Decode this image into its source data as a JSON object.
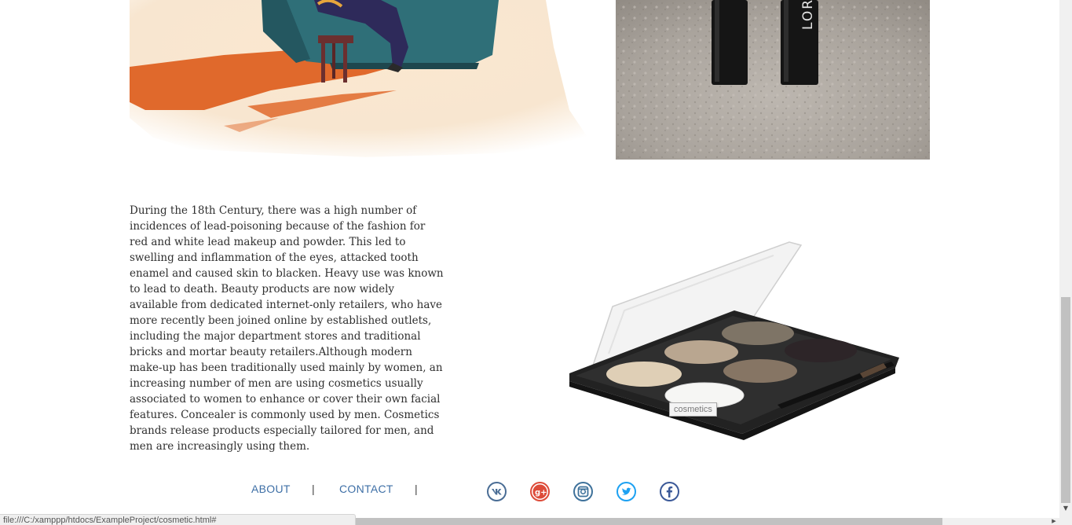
{
  "article": {
    "text": "During the 18th Century, there was a high number of incidences of lead-poisoning because of the fashion for red and white lead makeup and powder. This led to swelling and inflammation of the eyes, attacked tooth enamel and caused skin to blacken. Heavy use was known to lead to death. Beauty products are now widely available from dedicated internet-only retailers, who have more recently been joined online by established outlets, including the major department stores and traditional bricks and mortar beauty retailers.Although modern make-up has been traditionally used mainly by women, an increasing number of men are using cosmetics usually associated to women to enhance or cover their own facial features. Concealer is commonly used by men. Cosmetics brands release products especially tailored for men, and men are increasingly using them."
  },
  "images": {
    "palette_tooltip": "cosmetics",
    "mascara_brand_text": "LOR"
  },
  "footer": {
    "links": [
      "ABOUT",
      "CONTACT"
    ],
    "separator": "|",
    "social_icons": [
      "vk-icon",
      "google-plus-icon",
      "instagram-icon",
      "twitter-icon",
      "facebook-icon"
    ]
  },
  "colors": {
    "link": "#3e6fa6",
    "vk": "#4a6d95",
    "google_plus": "#dd4b39",
    "instagram": "#3f729b",
    "twitter": "#1da1f2",
    "facebook": "#3b5998"
  },
  "status_bar": {
    "url": "file:///C:/xamppp/htdocs/ExampleProject/cosmetic.html#"
  }
}
